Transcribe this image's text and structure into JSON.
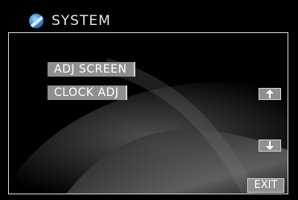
{
  "header": {
    "title": "SYSTEM",
    "logo_icon": "logo-icon"
  },
  "menu": {
    "items": [
      {
        "label": "ADJ SCREEN"
      },
      {
        "label": "CLOCK ADJ"
      }
    ]
  },
  "nav": {
    "up_icon": "arrow-up-icon",
    "down_icon": "arrow-down-icon",
    "exit_label": "EXIT"
  },
  "colors": {
    "background": "#000000",
    "button": "#8f8f8f",
    "border": "#d8d8d8",
    "text": "#ffffff",
    "logo": "#3e8fd6"
  }
}
